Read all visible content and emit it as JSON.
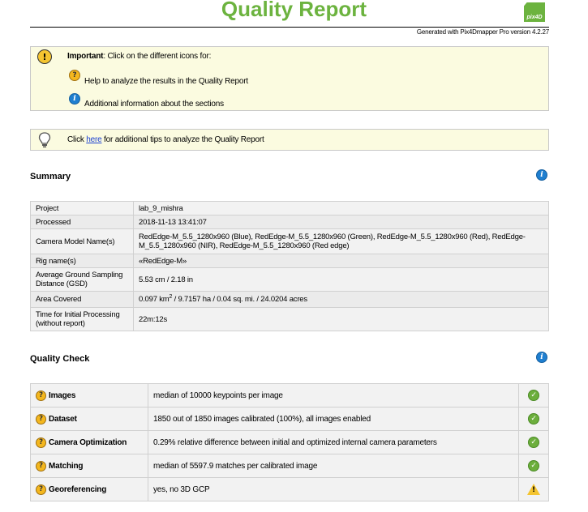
{
  "header": {
    "title": "Quality Report",
    "logo_text": "pix4D",
    "generated": "Generated with Pix4Dmapper Pro version 4.2.27"
  },
  "important_box": {
    "label": "Important",
    "text": ": Click on the different icons for:",
    "help_text": "Help to analyze the results in the Quality Report",
    "info_text": "Additional information about the sections"
  },
  "tip_box": {
    "prefix": "Click ",
    "link": "here",
    "suffix": " for additional tips to analyze the Quality Report"
  },
  "summary": {
    "heading": "Summary",
    "rows": [
      {
        "key": "Project",
        "value": "lab_9_mishra"
      },
      {
        "key": "Processed",
        "value": "2018-11-13 13:41:07"
      },
      {
        "key": "Camera Model Name(s)",
        "value": "RedEdge-M_5.5_1280x960 (Blue), RedEdge-M_5.5_1280x960 (Green), RedEdge-M_5.5_1280x960 (Red), RedEdge-M_5.5_1280x960 (NIR), RedEdge-M_5.5_1280x960 (Red edge)"
      },
      {
        "key": "Rig name(s)",
        "value": "«RedEdge-M»"
      },
      {
        "key": "Average Ground Sampling Distance (GSD)",
        "value": "5.53 cm / 2.18 in"
      },
      {
        "key": "Area Covered",
        "value_pre": "0.097 km",
        "value_sup": "2",
        "value_post": " / 9.7157 ha / 0.04 sq. mi. / 24.0204 acres"
      },
      {
        "key": "Time for Initial Processing (without report)",
        "value": "22m:12s"
      }
    ]
  },
  "quality_check": {
    "heading": "Quality Check",
    "rows": [
      {
        "name": "Images",
        "value": "median of 10000 keypoints per image",
        "status": "ok"
      },
      {
        "name": "Dataset",
        "value": "1850 out of 1850 images calibrated (100%), all images enabled",
        "status": "ok"
      },
      {
        "name": "Camera Optimization",
        "value": "0.29% relative difference between initial and optimized internal camera parameters",
        "status": "ok"
      },
      {
        "name": "Matching",
        "value": "median of 5597.9 matches per calibrated image",
        "status": "ok"
      },
      {
        "name": "Georeferencing",
        "value": "yes, no 3D GCP",
        "status": "warning"
      }
    ]
  },
  "colors": {
    "brand_green": "#6cb33f",
    "box_bg": "#fbfbe0",
    "info_blue": "#1f7fd0",
    "help_orange": "#f4b71e",
    "ok_green": "#6cae3c",
    "warning_yellow": "#f4c430"
  }
}
